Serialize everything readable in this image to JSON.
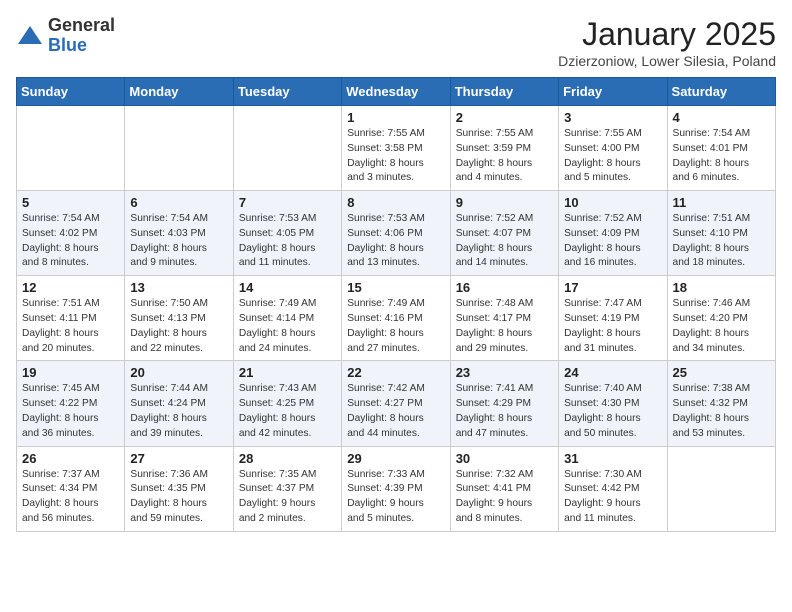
{
  "logo": {
    "general": "General",
    "blue": "Blue"
  },
  "header": {
    "month": "January 2025",
    "location": "Dzierzoniow, Lower Silesia, Poland"
  },
  "weekdays": [
    "Sunday",
    "Monday",
    "Tuesday",
    "Wednesday",
    "Thursday",
    "Friday",
    "Saturday"
  ],
  "weeks": [
    [
      {
        "day": "",
        "info": ""
      },
      {
        "day": "",
        "info": ""
      },
      {
        "day": "",
        "info": ""
      },
      {
        "day": "1",
        "info": "Sunrise: 7:55 AM\nSunset: 3:58 PM\nDaylight: 8 hours\nand 3 minutes."
      },
      {
        "day": "2",
        "info": "Sunrise: 7:55 AM\nSunset: 3:59 PM\nDaylight: 8 hours\nand 4 minutes."
      },
      {
        "day": "3",
        "info": "Sunrise: 7:55 AM\nSunset: 4:00 PM\nDaylight: 8 hours\nand 5 minutes."
      },
      {
        "day": "4",
        "info": "Sunrise: 7:54 AM\nSunset: 4:01 PM\nDaylight: 8 hours\nand 6 minutes."
      }
    ],
    [
      {
        "day": "5",
        "info": "Sunrise: 7:54 AM\nSunset: 4:02 PM\nDaylight: 8 hours\nand 8 minutes."
      },
      {
        "day": "6",
        "info": "Sunrise: 7:54 AM\nSunset: 4:03 PM\nDaylight: 8 hours\nand 9 minutes."
      },
      {
        "day": "7",
        "info": "Sunrise: 7:53 AM\nSunset: 4:05 PM\nDaylight: 8 hours\nand 11 minutes."
      },
      {
        "day": "8",
        "info": "Sunrise: 7:53 AM\nSunset: 4:06 PM\nDaylight: 8 hours\nand 13 minutes."
      },
      {
        "day": "9",
        "info": "Sunrise: 7:52 AM\nSunset: 4:07 PM\nDaylight: 8 hours\nand 14 minutes."
      },
      {
        "day": "10",
        "info": "Sunrise: 7:52 AM\nSunset: 4:09 PM\nDaylight: 8 hours\nand 16 minutes."
      },
      {
        "day": "11",
        "info": "Sunrise: 7:51 AM\nSunset: 4:10 PM\nDaylight: 8 hours\nand 18 minutes."
      }
    ],
    [
      {
        "day": "12",
        "info": "Sunrise: 7:51 AM\nSunset: 4:11 PM\nDaylight: 8 hours\nand 20 minutes."
      },
      {
        "day": "13",
        "info": "Sunrise: 7:50 AM\nSunset: 4:13 PM\nDaylight: 8 hours\nand 22 minutes."
      },
      {
        "day": "14",
        "info": "Sunrise: 7:49 AM\nSunset: 4:14 PM\nDaylight: 8 hours\nand 24 minutes."
      },
      {
        "day": "15",
        "info": "Sunrise: 7:49 AM\nSunset: 4:16 PM\nDaylight: 8 hours\nand 27 minutes."
      },
      {
        "day": "16",
        "info": "Sunrise: 7:48 AM\nSunset: 4:17 PM\nDaylight: 8 hours\nand 29 minutes."
      },
      {
        "day": "17",
        "info": "Sunrise: 7:47 AM\nSunset: 4:19 PM\nDaylight: 8 hours\nand 31 minutes."
      },
      {
        "day": "18",
        "info": "Sunrise: 7:46 AM\nSunset: 4:20 PM\nDaylight: 8 hours\nand 34 minutes."
      }
    ],
    [
      {
        "day": "19",
        "info": "Sunrise: 7:45 AM\nSunset: 4:22 PM\nDaylight: 8 hours\nand 36 minutes."
      },
      {
        "day": "20",
        "info": "Sunrise: 7:44 AM\nSunset: 4:24 PM\nDaylight: 8 hours\nand 39 minutes."
      },
      {
        "day": "21",
        "info": "Sunrise: 7:43 AM\nSunset: 4:25 PM\nDaylight: 8 hours\nand 42 minutes."
      },
      {
        "day": "22",
        "info": "Sunrise: 7:42 AM\nSunset: 4:27 PM\nDaylight: 8 hours\nand 44 minutes."
      },
      {
        "day": "23",
        "info": "Sunrise: 7:41 AM\nSunset: 4:29 PM\nDaylight: 8 hours\nand 47 minutes."
      },
      {
        "day": "24",
        "info": "Sunrise: 7:40 AM\nSunset: 4:30 PM\nDaylight: 8 hours\nand 50 minutes."
      },
      {
        "day": "25",
        "info": "Sunrise: 7:38 AM\nSunset: 4:32 PM\nDaylight: 8 hours\nand 53 minutes."
      }
    ],
    [
      {
        "day": "26",
        "info": "Sunrise: 7:37 AM\nSunset: 4:34 PM\nDaylight: 8 hours\nand 56 minutes."
      },
      {
        "day": "27",
        "info": "Sunrise: 7:36 AM\nSunset: 4:35 PM\nDaylight: 8 hours\nand 59 minutes."
      },
      {
        "day": "28",
        "info": "Sunrise: 7:35 AM\nSunset: 4:37 PM\nDaylight: 9 hours\nand 2 minutes."
      },
      {
        "day": "29",
        "info": "Sunrise: 7:33 AM\nSunset: 4:39 PM\nDaylight: 9 hours\nand 5 minutes."
      },
      {
        "day": "30",
        "info": "Sunrise: 7:32 AM\nSunset: 4:41 PM\nDaylight: 9 hours\nand 8 minutes."
      },
      {
        "day": "31",
        "info": "Sunrise: 7:30 AM\nSunset: 4:42 PM\nDaylight: 9 hours\nand 11 minutes."
      },
      {
        "day": "",
        "info": ""
      }
    ]
  ]
}
